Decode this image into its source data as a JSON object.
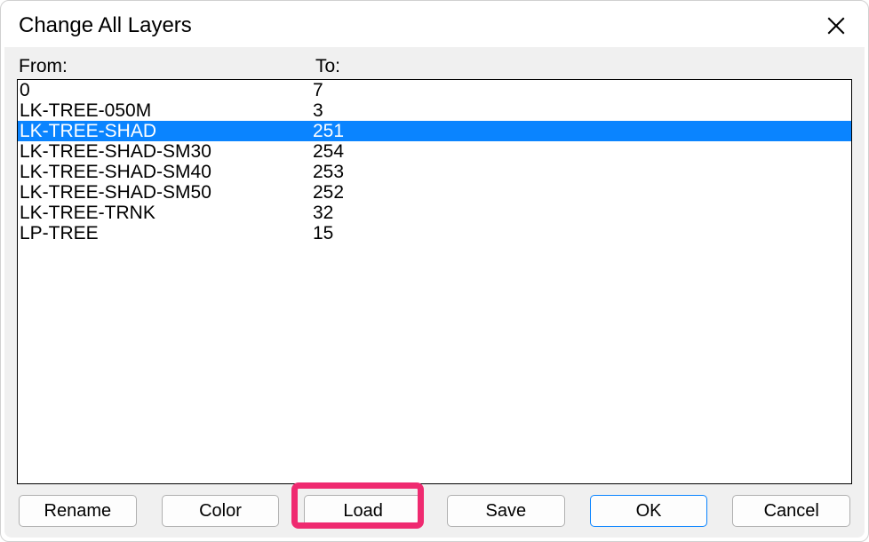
{
  "dialog": {
    "title": "Change All Layers"
  },
  "headers": {
    "from": "From:",
    "to": "To:"
  },
  "rows": [
    {
      "from": "0",
      "to": "7",
      "selected": false
    },
    {
      "from": "LK-TREE-050M",
      "to": "3",
      "selected": false
    },
    {
      "from": "LK-TREE-SHAD",
      "to": "251",
      "selected": true
    },
    {
      "from": "LK-TREE-SHAD-SM30",
      "to": "254",
      "selected": false
    },
    {
      "from": "LK-TREE-SHAD-SM40",
      "to": "253",
      "selected": false
    },
    {
      "from": "LK-TREE-SHAD-SM50",
      "to": "252",
      "selected": false
    },
    {
      "from": "LK-TREE-TRNK",
      "to": "32",
      "selected": false
    },
    {
      "from": "LP-TREE",
      "to": "15",
      "selected": false
    }
  ],
  "buttons": {
    "rename": "Rename",
    "color": "Color",
    "load": "Load",
    "save": "Save",
    "ok": "OK",
    "cancel": "Cancel"
  },
  "highlight": {
    "target": "load-button",
    "color": "#ef2a70"
  }
}
